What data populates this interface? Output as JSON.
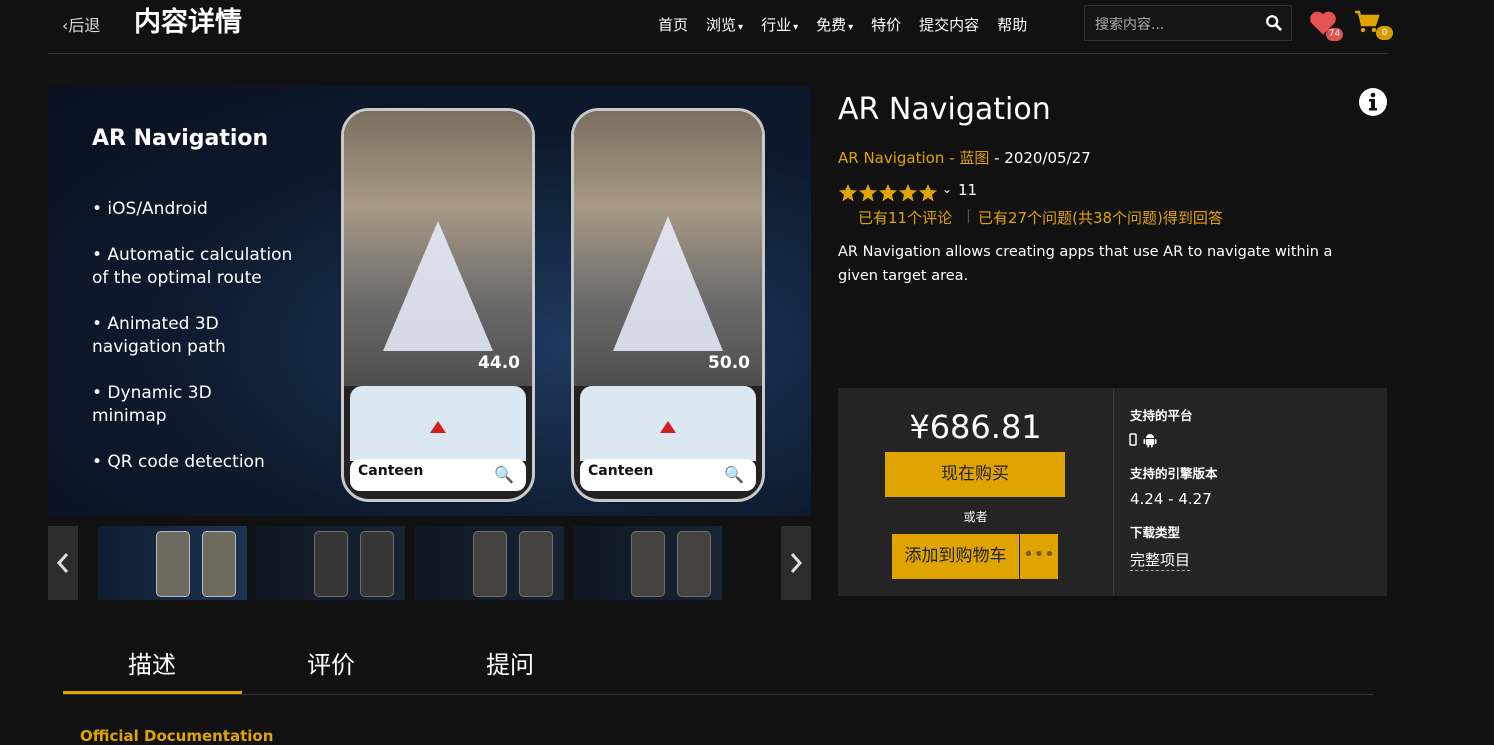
{
  "header": {
    "back_label": "后退",
    "page_title": "内容详情",
    "nav": [
      {
        "label": "首页",
        "dropdown": false
      },
      {
        "label": "浏览",
        "dropdown": true
      },
      {
        "label": "行业",
        "dropdown": true
      },
      {
        "label": "免费",
        "dropdown": true
      },
      {
        "label": "特价",
        "dropdown": false
      },
      {
        "label": "提交内容",
        "dropdown": false
      },
      {
        "label": "帮助",
        "dropdown": false
      }
    ],
    "search_placeholder": "搜索内容...",
    "wishlist_count": "74",
    "cart_count": "0"
  },
  "hero": {
    "title": "AR Navigation",
    "bullets": [
      "• iOS/Android",
      "• Automatic calculation\nof the optimal route",
      "• Animated 3D\nnavigation path",
      "• Dynamic 3D\nminimap",
      "• QR code detection"
    ],
    "phones": [
      {
        "distance": "44.0",
        "label": "Canteen"
      },
      {
        "distance": "50.0",
        "label": "Canteen"
      }
    ]
  },
  "product": {
    "title": "AR Navigation",
    "publisher": "AR Navigation",
    "type": "蓝图",
    "date": "2020/05/27",
    "rating": 5,
    "rating_count": "11",
    "reviews_text": "已有11个评论",
    "qa_text": "已有27个问题(共38个问题)得到回答",
    "description": "AR Navigation allows creating apps that use AR to navigate within a given target area."
  },
  "purchase": {
    "price": "¥686.81",
    "buy_now": "现在购买",
    "or": "或者",
    "add_to_cart": "添加到购物车",
    "more": "•••",
    "platforms_heading": "支持的平台",
    "engine_heading": "支持的引擎版本",
    "engine_versions": "4.24 - 4.27",
    "download_heading": "下载类型",
    "download_type": "完整项目"
  },
  "tabs": [
    "描述",
    "评价",
    "提问"
  ],
  "doc_link": "Official Documentation",
  "colors": {
    "accent": "#e0a400",
    "background": "#111111",
    "panel": "#242424",
    "heart": "#e55252"
  }
}
